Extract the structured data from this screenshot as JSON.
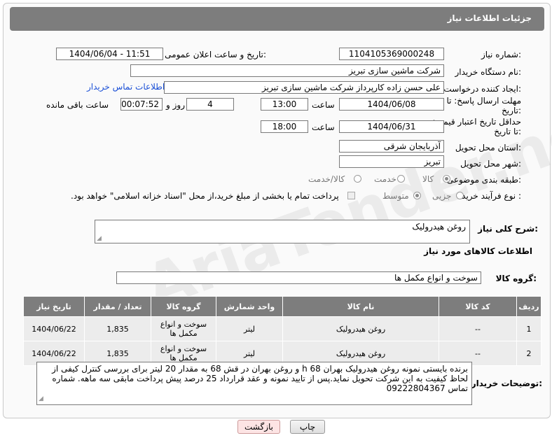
{
  "header": {
    "title": "جزئیات اطلاعات نیاز"
  },
  "watermark": "AriaTender.neT",
  "fields": {
    "need_number_label": "شماره نیاز:",
    "need_number": "1104105369000248",
    "announce_label": "تاریخ و ساعت اعلان عمومی:",
    "announce_value": "1404/06/04 - 11:51",
    "buyer_org_label": "نام دستگاه خریدار:",
    "buyer_org": "شرکت ماشین سازی تبریز",
    "creator_label": "ایجاد کننده درخواست:",
    "creator": "علی حسن زاده کارپرداز شرکت ماشین سازی تبریز",
    "buyer_contact_link": "اطلاعات تماس خریدار",
    "deadline_label": "مهلت ارسال پاسخ: تا تاریخ:",
    "deadline_date": "1404/06/08",
    "time_word": "ساعت",
    "deadline_time": "13:00",
    "days_value": "4",
    "days_and_label": "روز و",
    "remaining_time": "00:07:52",
    "remaining_label": "ساعت باقی مانده",
    "min_validity_label": "حداقل تاریخ اعتبار قیمت: تا تاریخ:",
    "validity_date": "1404/06/31",
    "validity_time": "18:00",
    "province_label": "استان محل تحویل:",
    "province": "آذربایجان شرقی",
    "city_label": "شهر محل تحویل:",
    "city": "تبریز",
    "category_label": "طبقه بندی موضوعی:",
    "category_options": [
      "کالا",
      "خدمت",
      "کالا/خدمت"
    ],
    "process_label": "نوع فرآیند خرید :",
    "process_options": [
      "جزیی",
      "متوسط"
    ],
    "payment_note": "پرداخت تمام یا بخشی از مبلغ خرید،از محل \"اسناد خزانه اسلامی\" خواهد بود."
  },
  "summary": {
    "label": "شرح کلی نیاز:",
    "value": "روغن هیدرولیک"
  },
  "goods_info_title": "اطلاعات کالاهای مورد نیاز",
  "goods_group": {
    "label": "گروه کالا:",
    "value": "سوخت و انواع مکمل ها"
  },
  "table": {
    "headers": [
      "ردیف",
      "کد کالا",
      "نام کالا",
      "واحد شمارش",
      "گروه کالا",
      "تعداد / مقدار",
      "تاریخ نیاز"
    ],
    "rows": [
      [
        "1",
        "--",
        "روغن هیدرولیک",
        "لیتر",
        "سوخت و انواع مکمل ها",
        "1,835",
        "1404/06/22"
      ],
      [
        "2",
        "--",
        "روغن هیدرولیک",
        "لیتر",
        "سوخت و انواع مکمل ها",
        "1,835",
        "1404/06/22"
      ]
    ]
  },
  "buyer_notes": {
    "label": "توضیحات خریدار:",
    "value": "برنده بایستی نمونه روغن هیدرولیک بهران h 68 و روغن بهران در قش 68  به مقدار 20 لیتر برای بررسی کنترل کیفی از لحاظ کیفیت به این شرکت تحویل نماید.پس از تایید نمونه و عقد قرارداد 25 درصد پیش پرداخت مابقی سه ماهه. شماره تماس 09222804367"
  },
  "buttons": {
    "print": "چاپ",
    "back": "بازگشت"
  }
}
